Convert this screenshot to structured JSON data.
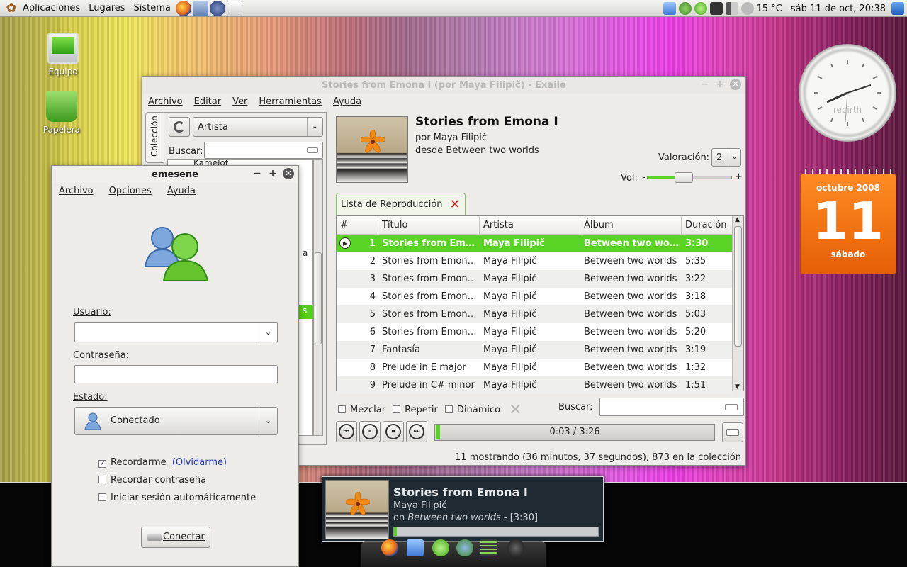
{
  "topbar": {
    "menus": [
      "Aplicaciones",
      "Lugares",
      "Sistema"
    ],
    "temperature": "15 °C",
    "datetime": "sáb 11 de oct, 20:38"
  },
  "desktop": {
    "icons": [
      {
        "label": "Equipo"
      },
      {
        "label": "Papelera"
      }
    ]
  },
  "exaile": {
    "title": "Stories from Emona I (por Maya Filipič) - Exaile",
    "menus": [
      "Archivo",
      "Editar",
      "Ver",
      "Herramientas",
      "Ayuda"
    ],
    "collection_tab": "Colección",
    "collection_combo": "Artista",
    "search_label": "Buscar:",
    "tree_first": "Kamelot",
    "tree_peek_1": "a",
    "tree_peek_2": "s",
    "track": {
      "title": "Stories from Emona I",
      "by": "por Maya Filipič",
      "from": "desde Between two worlds"
    },
    "rating_label": "Valoración:",
    "rating_value": "2",
    "vol_label": "Vol:",
    "vol_minus": "-",
    "vol_plus": "+",
    "playlist_tab": "Lista de Reproducción",
    "columns": [
      "#",
      "Título",
      "Artista",
      "Álbum",
      "Duración"
    ],
    "rows": [
      [
        "1",
        "Stories from Emona I",
        "Maya Filipič",
        "Between two worlds",
        "3:30"
      ],
      [
        "2",
        "Stories from Emona II",
        "Maya Filipič",
        "Between two worlds",
        "5:35"
      ],
      [
        "3",
        "Stories from Emona III",
        "Maya Filipič",
        "Between two worlds",
        "3:22"
      ],
      [
        "4",
        "Stories from Emona IV",
        "Maya Filipič",
        "Between two worlds",
        "3:18"
      ],
      [
        "5",
        "Stories from Emona V",
        "Maya Filipič",
        "Between two worlds",
        "5:03"
      ],
      [
        "6",
        "Stories from Emona VI",
        "Maya Filipič",
        "Between two worlds",
        "5:20"
      ],
      [
        "7",
        "Fantasía",
        "Maya Filipič",
        "Between two worlds",
        "3:19"
      ],
      [
        "8",
        "Prelude in E major",
        "Maya Filipič",
        "Between two worlds",
        "1:32"
      ],
      [
        "9",
        "Prelude in C# minor",
        "Maya Filipič",
        "Between two worlds",
        "1:51"
      ]
    ],
    "options": {
      "shuffle": "Mezclar",
      "repeat": "Repetir",
      "dynamic": "Dinámico",
      "search": "Buscar:"
    },
    "time": "0:03 / 3:26",
    "progress": 0.015,
    "status": "11 mostrando (36 minutos, 37 segundos), 873 en la colección"
  },
  "emesene": {
    "title": "emesene",
    "menus": [
      "Archivo",
      "Opciones",
      "Ayuda"
    ],
    "user_label": "Usuario:",
    "password_label": "Contraseña:",
    "status_label": "Estado:",
    "status_value": "Conectado",
    "remember": "Recordarme",
    "forget": "(Olvidarme)",
    "remember_password": "Recordar contraseña",
    "autologin": "Iniciar sesión automáticamente",
    "connect": "Conectar"
  },
  "notification": {
    "title": "Stories from Emona I",
    "artist": "Maya Filipič",
    "on": "on",
    "album": "Between two worlds",
    "duration": "- [3:30]",
    "progress": 0.015
  },
  "clock": {
    "brand": "rebirth"
  },
  "calendar": {
    "month": "octubre 2008",
    "day": "11",
    "weekday": "sábado"
  }
}
